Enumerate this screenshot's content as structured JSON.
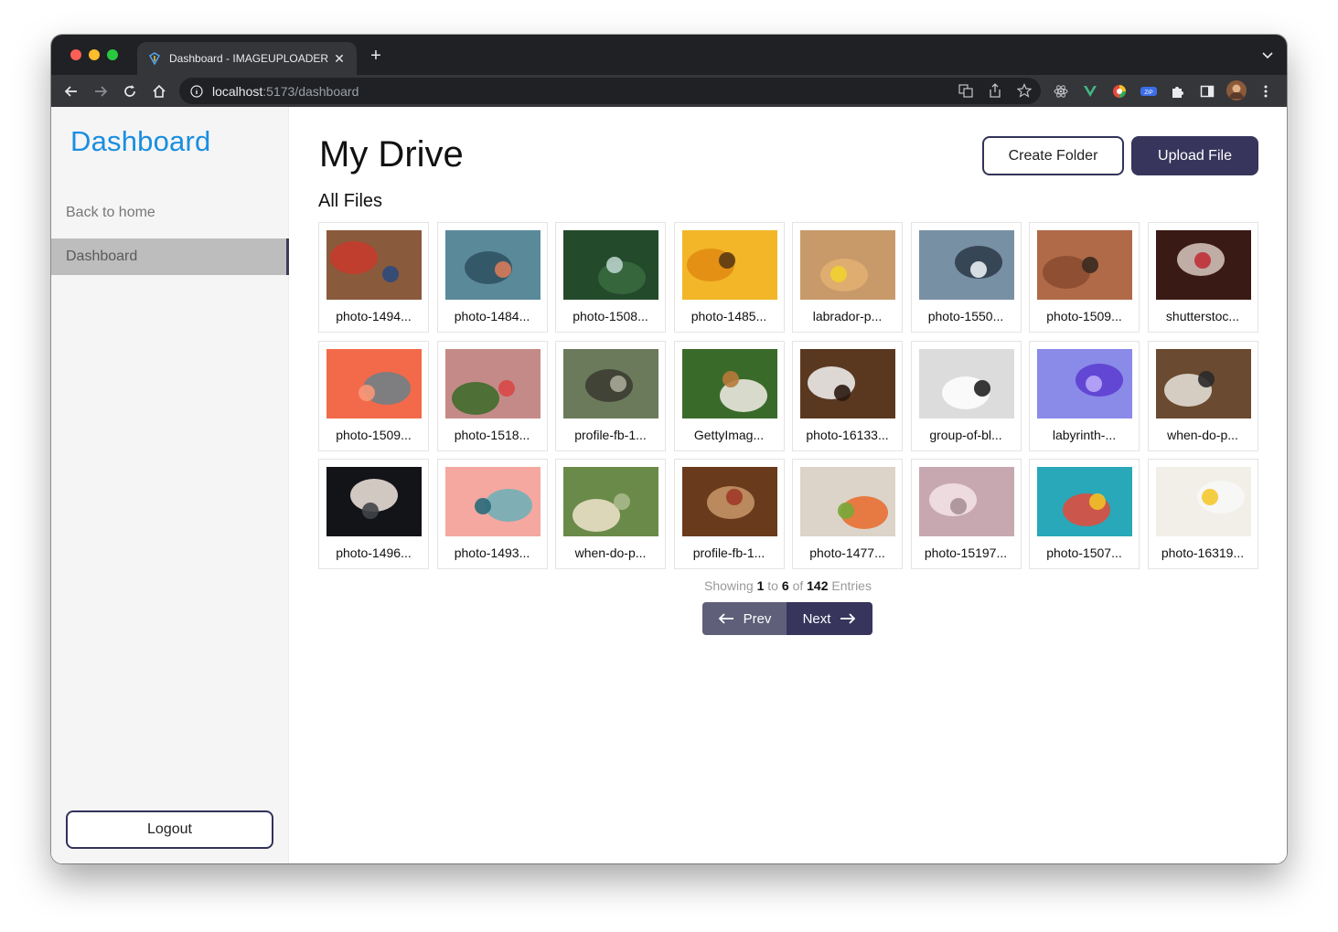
{
  "browser": {
    "tab_title": "Dashboard - IMAGEUPLOADER",
    "url_host": "localhost",
    "url_path": ":5173/dashboard"
  },
  "sidebar": {
    "title": "Dashboard",
    "items": [
      {
        "label": "Back to home"
      },
      {
        "label": "Dashboard"
      }
    ],
    "logout_label": "Logout"
  },
  "main": {
    "heading": "My Drive",
    "create_folder_label": "Create Folder",
    "upload_file_label": "Upload File",
    "subheading": "All Files",
    "files": [
      {
        "name": "photo-1494...",
        "bg": "#8a5a3c",
        "fg": "#c83a2a",
        "accent": "#2e4a7a"
      },
      {
        "name": "photo-1484...",
        "bg": "#5a8a9a",
        "fg": "#2d5060",
        "accent": "#d77a5a"
      },
      {
        "name": "photo-1508...",
        "bg": "#244a2c",
        "fg": "#3a6c40",
        "accent": "#b8d0c8"
      },
      {
        "name": "photo-1485...",
        "bg": "#f2b628",
        "fg": "#e08a10",
        "accent": "#5a3a10"
      },
      {
        "name": "labrador-p...",
        "bg": "#c89a6a",
        "fg": "#e2b070",
        "accent": "#f0d030"
      },
      {
        "name": "photo-1550...",
        "bg": "#7890a4",
        "fg": "#2c3a48",
        "accent": "#e8eef4"
      },
      {
        "name": "photo-1509...",
        "bg": "#b06a48",
        "fg": "#8a4a30",
        "accent": "#3a2a20"
      },
      {
        "name": "shutterstoc...",
        "bg": "#3a1a14",
        "fg": "#d8c8c0",
        "accent": "#c03038"
      },
      {
        "name": "photo-1509...",
        "bg": "#f26a4a",
        "fg": "#6a8088",
        "accent": "#fa9878"
      },
      {
        "name": "photo-1518...",
        "bg": "#c48a88",
        "fg": "#3a6a28",
        "accent": "#d84848"
      },
      {
        "name": "profile-fb-1...",
        "bg": "#6a7a5a",
        "fg": "#3a3a30",
        "accent": "#a8a898"
      },
      {
        "name": "GettyImag...",
        "bg": "#3a6a2a",
        "fg": "#f4efe8",
        "accent": "#b87a3a"
      },
      {
        "name": "photo-16133...",
        "bg": "#5a3820",
        "fg": "#f4f4f4",
        "accent": "#2a1a10"
      },
      {
        "name": "group-of-bl...",
        "bg": "#dcdcdc",
        "fg": "#ffffff",
        "accent": "#222222"
      },
      {
        "name": "labyrinth-...",
        "bg": "#8a8ae8",
        "fg": "#5a3ad0",
        "accent": "#b8a8f8"
      },
      {
        "name": "when-do-p...",
        "bg": "#6a4a30",
        "fg": "#e8e4dc",
        "accent": "#2a2a2a"
      },
      {
        "name": "photo-1496...",
        "bg": "#121418",
        "fg": "#f4e8e0",
        "accent": "#404448"
      },
      {
        "name": "photo-1493...",
        "bg": "#f4a8a0",
        "fg": "#6ab0b8",
        "accent": "#2a6a7a"
      },
      {
        "name": "when-do-p...",
        "bg": "#6a8a4a",
        "fg": "#f0e4cc",
        "accent": "#a8b88a"
      },
      {
        "name": "profile-fb-1...",
        "bg": "#6a3a1c",
        "fg": "#c89868",
        "accent": "#a03a28"
      },
      {
        "name": "photo-1477...",
        "bg": "#dcd4c8",
        "fg": "#e86a2a",
        "accent": "#78a838"
      },
      {
        "name": "photo-15197...",
        "bg": "#c8a8b0",
        "fg": "#f4e4e8",
        "accent": "#a89098"
      },
      {
        "name": "photo-1507...",
        "bg": "#28a8b8",
        "fg": "#e84838",
        "accent": "#f0c028"
      },
      {
        "name": "photo-16319...",
        "bg": "#f2efe8",
        "fg": "#f8f8f8",
        "accent": "#f4c830"
      }
    ]
  },
  "pagination": {
    "showing_text": "Showing",
    "from": "1",
    "to_text": "to",
    "to": "6",
    "of_text": "of",
    "total": "142",
    "entries_text": "Entries",
    "prev_label": "Prev",
    "next_label": "Next"
  }
}
